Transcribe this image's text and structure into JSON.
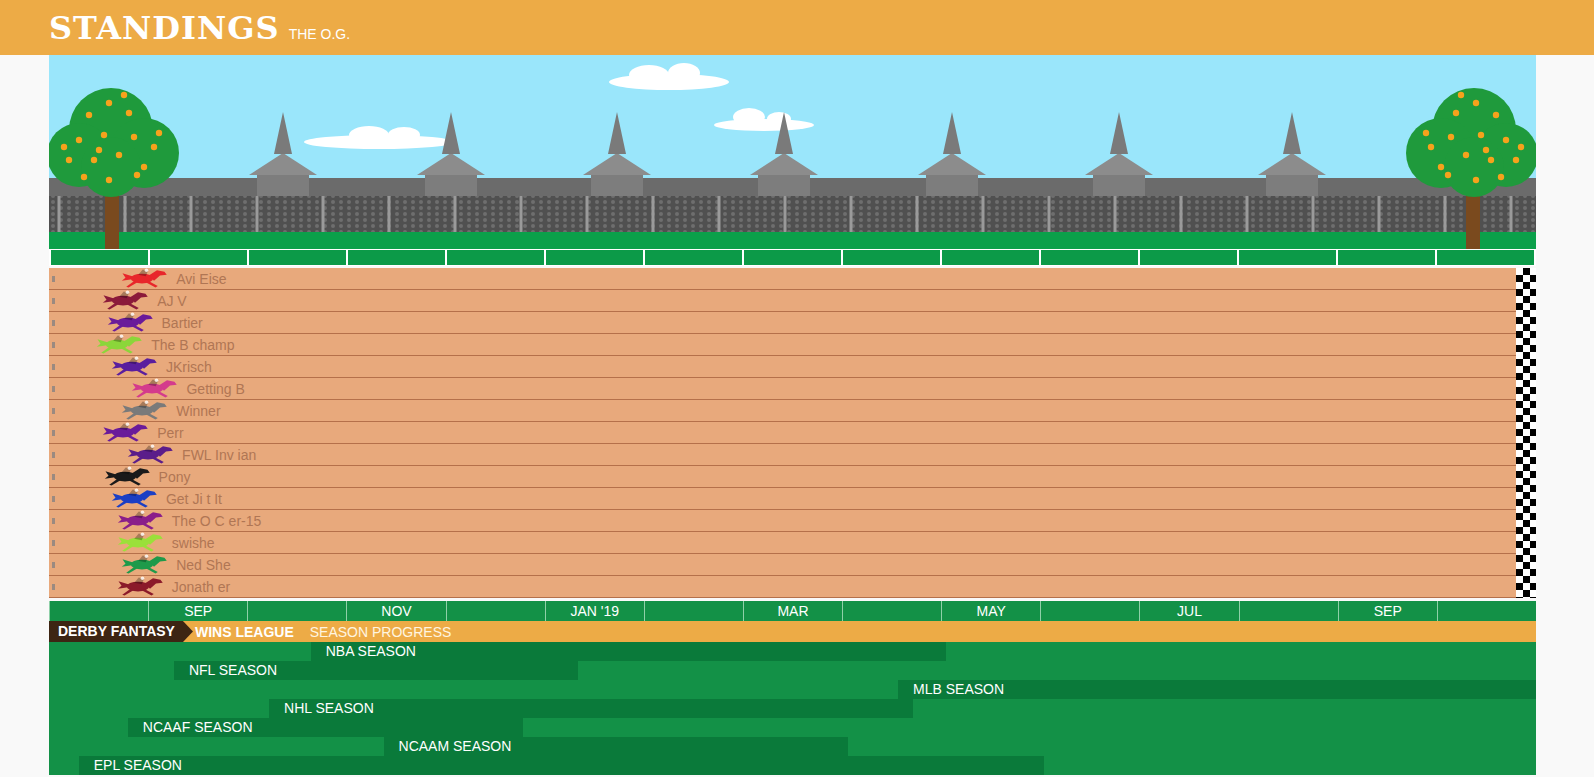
{
  "header": {
    "title": "STANDINGS",
    "subtitle": "THE O.G."
  },
  "racers": [
    {
      "name": "Avi Eise",
      "level": 0.039,
      "color": "#e8262b"
    },
    {
      "name": "AJ V",
      "level": 0.026,
      "color": "#8b1a3a"
    },
    {
      "name": "Bartier",
      "level": 0.029,
      "color": "#6a1b9a"
    },
    {
      "name": "The B champ",
      "level": 0.022,
      "color": "#8bd63a"
    },
    {
      "name": "JKrisch",
      "level": 0.032,
      "color": "#5a1e9e"
    },
    {
      "name": "Getting B",
      "level": 0.046,
      "color": "#d43b8c"
    },
    {
      "name": "Winner",
      "level": 0.039,
      "color": "#7a7a7a"
    },
    {
      "name": "Perr",
      "level": 0.026,
      "color": "#6a1b9a"
    },
    {
      "name": "FWL Inv ian",
      "level": 0.043,
      "color": "#5b1d8a"
    },
    {
      "name": "Pony",
      "level": 0.027,
      "color": "#1a1a1a"
    },
    {
      "name": "Get Ji t It",
      "level": 0.032,
      "color": "#1b3fc4"
    },
    {
      "name": "The O C er-15",
      "level": 0.036,
      "color": "#8a1e8a"
    },
    {
      "name": "swishe",
      "level": 0.036,
      "color": "#9be03a"
    },
    {
      "name": "Ned She",
      "level": 0.039,
      "color": "#1e9a4a"
    },
    {
      "name": "Jonath er",
      "level": 0.036,
      "color": "#8b1a2a"
    }
  ],
  "months": [
    "",
    "SEP",
    "",
    "NOV",
    "",
    "JAN '19",
    "",
    "MAR",
    "",
    "MAY",
    "",
    "JUL",
    "",
    "SEP",
    ""
  ],
  "footer": {
    "brand": "DERBY FANTASY",
    "league": "WINS LEAGUE",
    "section": "SEASON PROGRESS"
  },
  "seasons": [
    {
      "label": "NBA SEASON",
      "start": 0.176,
      "end": 0.603
    },
    {
      "label": "NFL SEASON",
      "start": 0.084,
      "end": 0.356
    },
    {
      "label": "MLB SEASON",
      "start": 0.571,
      "end": 1.0
    },
    {
      "label": "NHL SEASON",
      "start": 0.148,
      "end": 0.581
    },
    {
      "label": "NCAAF SEASON",
      "start": 0.053,
      "end": 0.319
    },
    {
      "label": "NCAAM SEASON",
      "start": 0.225,
      "end": 0.537
    },
    {
      "label": "EPL SEASON",
      "start": 0.02,
      "end": 0.669
    }
  ]
}
